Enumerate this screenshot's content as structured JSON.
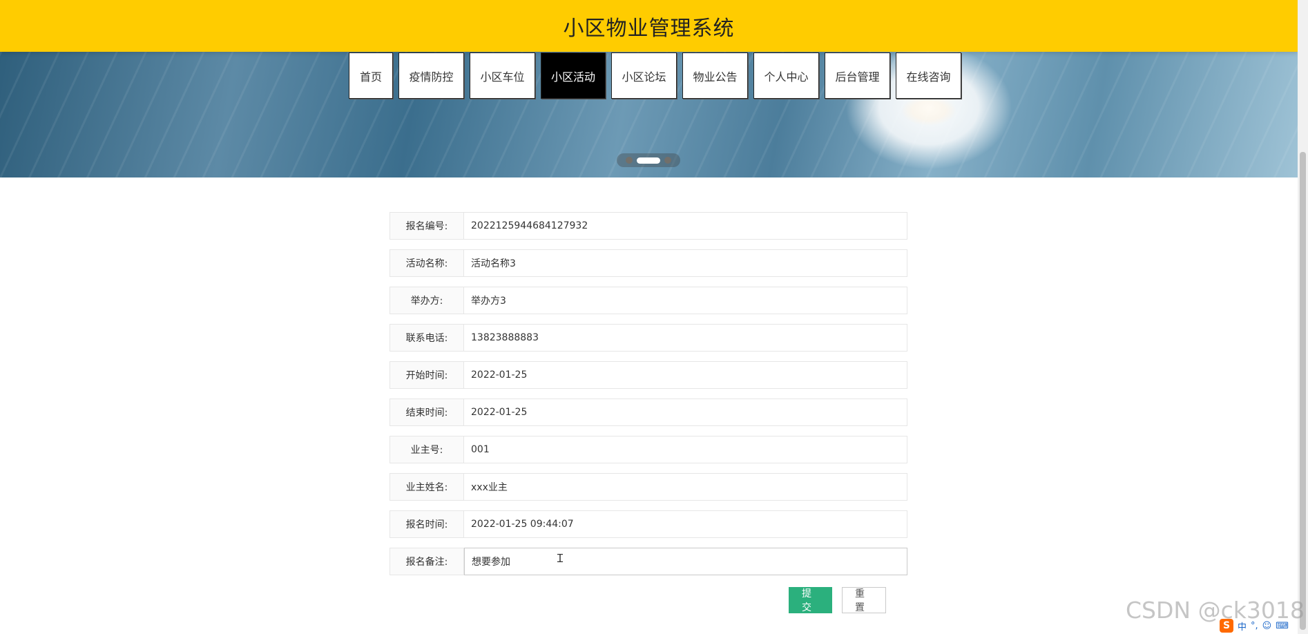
{
  "site": {
    "title": "小区物业管理系统"
  },
  "nav": {
    "items": [
      {
        "label": "首页"
      },
      {
        "label": "疫情防控"
      },
      {
        "label": "小区车位"
      },
      {
        "label": "小区活动"
      },
      {
        "label": "小区论坛"
      },
      {
        "label": "物业公告"
      },
      {
        "label": "个人中心"
      },
      {
        "label": "后台管理"
      },
      {
        "label": "在线咨询"
      }
    ],
    "active_index": 3
  },
  "form": {
    "fields": [
      {
        "label": "报名编号:",
        "value": "2022125944684127932"
      },
      {
        "label": "活动名称:",
        "value": "活动名称3"
      },
      {
        "label": "举办方:",
        "value": "举办方3"
      },
      {
        "label": "联系电话:",
        "value": "13823888883"
      },
      {
        "label": "开始时间:",
        "value": "2022-01-25"
      },
      {
        "label": "结束时间:",
        "value": "2022-01-25"
      },
      {
        "label": "业主号:",
        "value": "001"
      },
      {
        "label": "业主姓名:",
        "value": "xxx业主"
      },
      {
        "label": "报名时间:",
        "value": "2022-01-25 09:44:07"
      },
      {
        "label": "报名备注:",
        "value": "想要参加"
      }
    ]
  },
  "actions": {
    "submit_label": "提交",
    "reset_label": "重置"
  },
  "watermark": "CSDN @ck3018",
  "ime": {
    "logo": "S",
    "mode": "中"
  },
  "colors": {
    "header_bg": "#ffcc00",
    "nav_active_bg": "#000000",
    "submit_bg": "#2bb07d"
  }
}
